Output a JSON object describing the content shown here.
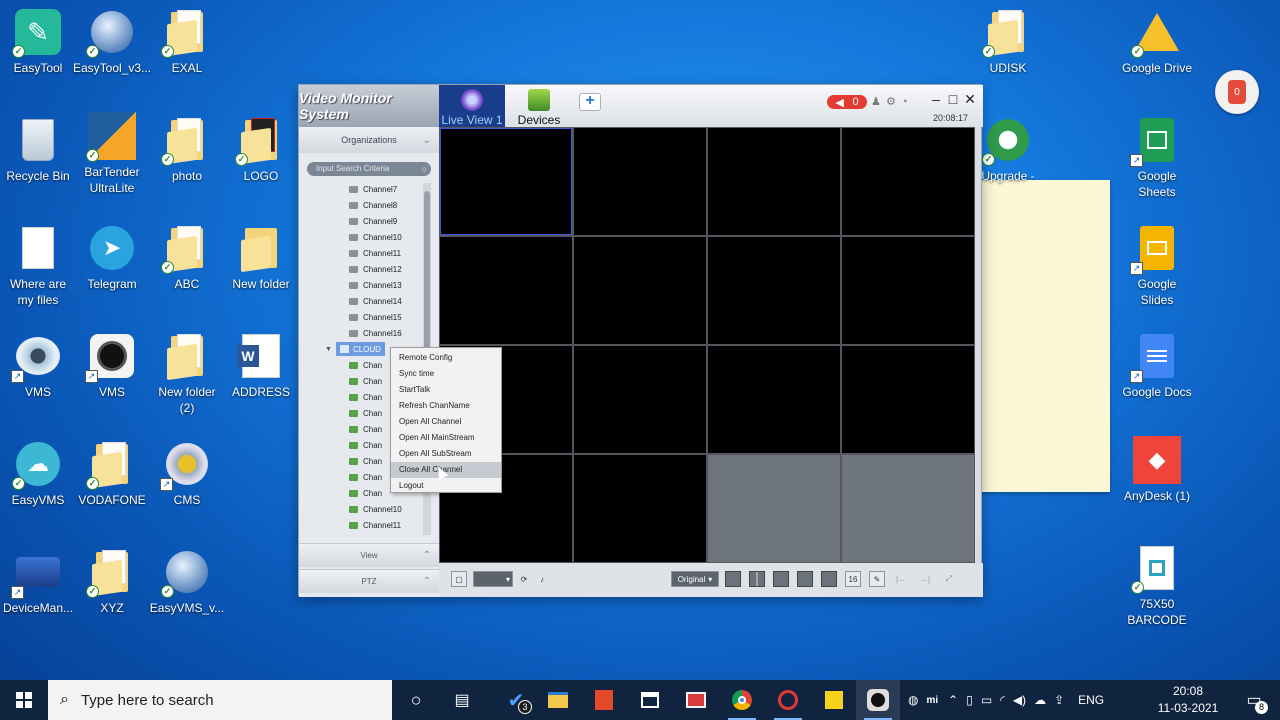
{
  "desktop": {
    "icons": [
      {
        "label": "EasyTool"
      },
      {
        "label": "EasyTool_v3..."
      },
      {
        "label": "EXAL"
      },
      {
        "label": "Recycle Bin"
      },
      {
        "label": "BarTender\nUltraLite"
      },
      {
        "label": "photo"
      },
      {
        "label": "LOGO"
      },
      {
        "label": "Where are\nmy files"
      },
      {
        "label": "Telegram"
      },
      {
        "label": "ABC"
      },
      {
        "label": "New folder"
      },
      {
        "label": "VMS"
      },
      {
        "label": "VMS"
      },
      {
        "label": "New folder\n(2)"
      },
      {
        "label": "ADDRESS"
      },
      {
        "label": "EasyVMS"
      },
      {
        "label": "VODAFONE"
      },
      {
        "label": "CMS"
      },
      {
        "label": "DeviceMan..."
      },
      {
        "label": "XYZ"
      },
      {
        "label": "EasyVMS_v..."
      },
      {
        "label": "UDISK"
      },
      {
        "label": "Google Drive"
      },
      {
        "label": "Upgrade -"
      },
      {
        "label": "Google\nSheets"
      },
      {
        "label": "Google\nSlides"
      },
      {
        "label": "Google Docs"
      },
      {
        "label": "AnyDesk (1)"
      },
      {
        "label": "75X50\nBARCODE"
      }
    ],
    "notification_badge": "0"
  },
  "app": {
    "brand": "Video Monitor System",
    "tabs": [
      {
        "label": "Live View 1"
      },
      {
        "label": "Devices"
      }
    ],
    "add_tab": "+",
    "alarm_count": "0",
    "time": "20:08:17",
    "sidebar": {
      "organizations": "Organizations",
      "search_placeholder": "Input Search Criteria",
      "channels_top": [
        "Channel7",
        "Channel8",
        "Channel9",
        "Channel10",
        "Channel11",
        "Channel12",
        "Channel13",
        "Channel14",
        "Channel15",
        "Channel16"
      ],
      "cloud_node": "CLOUD",
      "channels_cloud": [
        "Chan",
        "Chan",
        "Chan",
        "Chan",
        "Chan",
        "Chan",
        "Chan",
        "Chan",
        "Chan",
        "Channel10",
        "Channel11"
      ],
      "view": "View",
      "ptz": "PTZ"
    },
    "bottom": {
      "stream_mode": "Original",
      "layout_16": "16"
    },
    "context_menu": [
      "Remote Config",
      "Sync time",
      "StartTalk",
      "Refresh ChanName",
      "Open All Channel",
      "Open All MainStream",
      "Open All SubStream",
      "Close All Channel",
      "Logout"
    ],
    "highlighted_menu_index": 7
  },
  "taskbar": {
    "search_placeholder": "Type here to search",
    "todo_badge": "3",
    "language": "ENG",
    "time": "20:08",
    "date": "11-03-2021",
    "notifications": "8"
  }
}
